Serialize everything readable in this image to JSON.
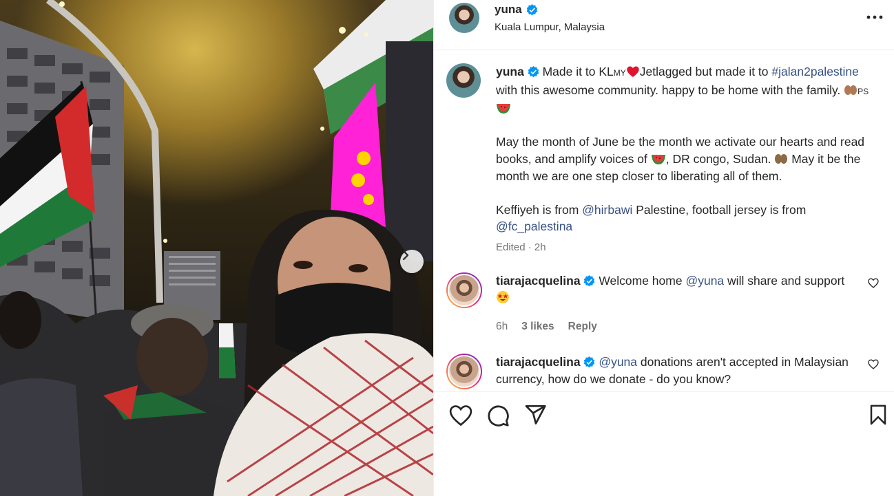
{
  "post": {
    "username": "yuna",
    "location": "Kuala Lumpur, Malaysia"
  },
  "caption": {
    "username": "yuna",
    "line1_a": "Made it to KL",
    "line1_flag": "MY",
    "line1_b": "Jetlagged but made it to",
    "hashtag": "#jalan2palestine",
    "line2": "with this awesome community. happy to be",
    "line3": "home with the family.",
    "line3_flag": "PS",
    "para2_a": "May the month of June be the month we activate our hearts and read books, and amplify voices of",
    "para2_b": ", DR congo, Sudan.",
    "para2_c": "May it be the month we are one step closer to liberating all of them.",
    "para3_a": "Keffiyeh is from",
    "mention1": "@hirbawi",
    "para3_b": "Palestine, football jersey is from",
    "mention2": "@fc_palestina",
    "edited": "Edited",
    "time": "2h"
  },
  "comments": [
    {
      "username": "tiarajacquelina",
      "text_a": "Welcome home",
      "mention": "@yuna",
      "text_b": "will share and support",
      "time": "6h",
      "likes": "3 likes",
      "reply": "Reply"
    },
    {
      "username": "tiarajacquelina",
      "mention": "@yuna",
      "text_b": "donations aren't accepted in Malaysian currency, how do we donate - do you know?"
    }
  ],
  "icons": {
    "verified": "verified-badge-icon",
    "more": "more-options-icon",
    "next": "chevron-right-icon",
    "like": "heart-icon",
    "comment": "comment-icon",
    "share": "share-icon",
    "save": "bookmark-icon"
  },
  "colors": {
    "verified": "#0095f6",
    "text": "#262626",
    "secondary": "#737373",
    "link": "#385185",
    "heart": "#e0142c"
  }
}
